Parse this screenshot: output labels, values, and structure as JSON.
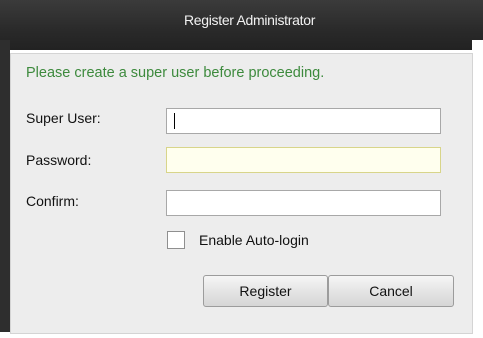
{
  "dialog": {
    "title": "Register Administrator",
    "message": "Please create a super user before proceeding."
  },
  "form": {
    "super_user_label": "Super User:",
    "super_user_value": "",
    "password_label": "Password:",
    "password_value": "",
    "confirm_label": "Confirm:",
    "confirm_value": "",
    "auto_login_label": "Enable Auto-login",
    "auto_login_checked": false
  },
  "buttons": {
    "register_label": "Register",
    "cancel_label": "Cancel"
  },
  "colors": {
    "message": "#3d8a3d",
    "title_bar": "#2a2a2a",
    "highlight_field": "#ffffee"
  }
}
